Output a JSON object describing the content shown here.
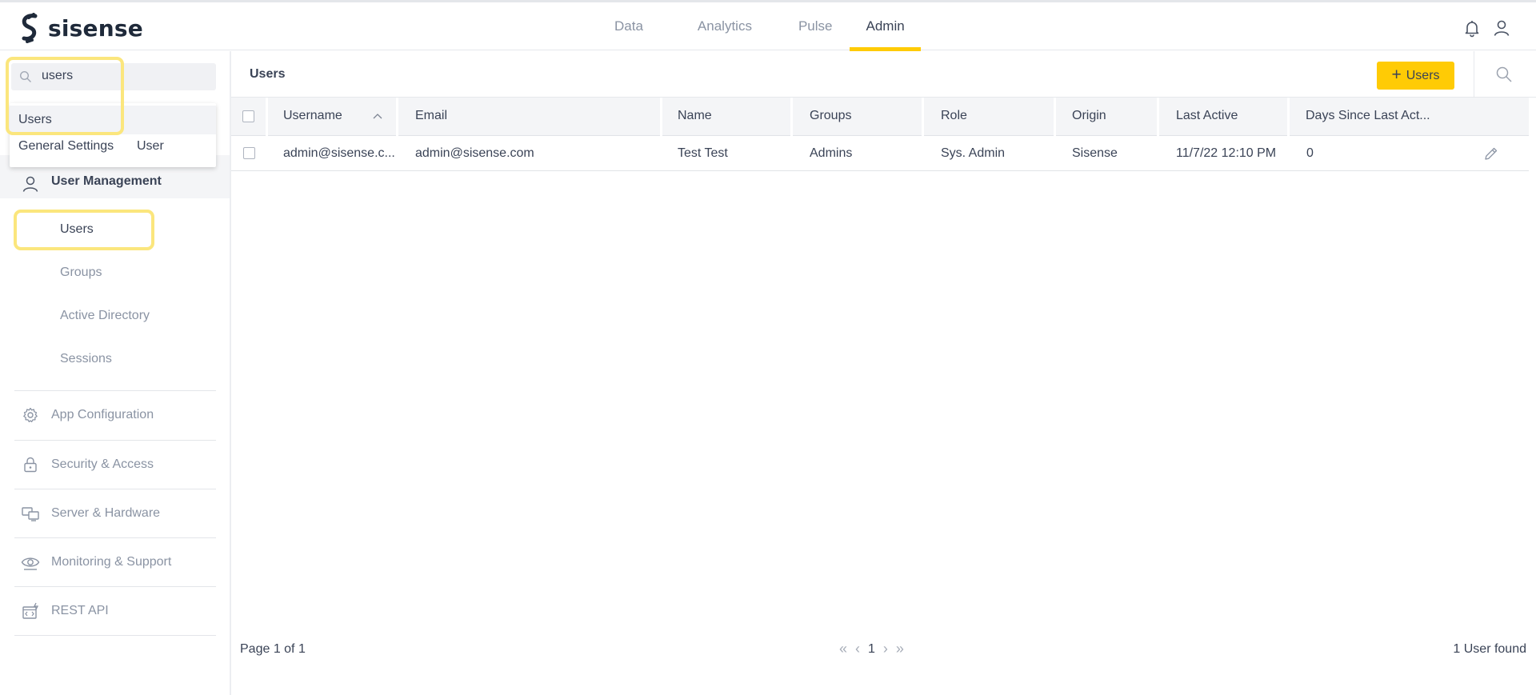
{
  "brand": {
    "name": "sisense"
  },
  "colors": {
    "accent": "#ffcb05",
    "highlight": "#fbe67d",
    "text": "#3a4356",
    "muted": "#8a93a3"
  },
  "nav": {
    "tabs": [
      {
        "label": "Data"
      },
      {
        "label": "Analytics"
      },
      {
        "label": "Pulse"
      },
      {
        "label": "Admin",
        "active": true
      }
    ],
    "icons": [
      "bell-icon",
      "user-icon"
    ]
  },
  "sidebar": {
    "search": {
      "value": "users"
    },
    "dropdown": {
      "top_result": "Users",
      "chips": [
        "General Settings",
        "User"
      ]
    },
    "group": {
      "label": "User Management"
    },
    "sub_items": [
      {
        "label": "Users",
        "active": true
      },
      {
        "label": "Groups"
      },
      {
        "label": "Active Directory"
      },
      {
        "label": "Sessions"
      }
    ],
    "sections": [
      {
        "label": "App Configuration",
        "icon": "gear-icon"
      },
      {
        "label": "Security & Access",
        "icon": "lock-icon"
      },
      {
        "label": "Server & Hardware",
        "icon": "server-icon"
      },
      {
        "label": "Monitoring & Support",
        "icon": "monitoring-icon"
      },
      {
        "label": "REST API",
        "icon": "rest-api-icon"
      }
    ]
  },
  "main": {
    "title": "Users",
    "add_button_label": "Users",
    "columns": [
      "Username",
      "Email",
      "Name",
      "Groups",
      "Role",
      "Origin",
      "Last Active",
      "Days Since Last Act..."
    ],
    "rows": [
      [
        "admin@sisense.c...",
        "admin@sisense.com",
        "Test Test",
        "Admins",
        "Sys. Admin",
        "Sisense",
        "11/7/22 12:10 PM",
        "0"
      ]
    ],
    "footer": {
      "page_info": "Page 1 of 1",
      "current_page": "1",
      "found": "1 User found"
    }
  }
}
